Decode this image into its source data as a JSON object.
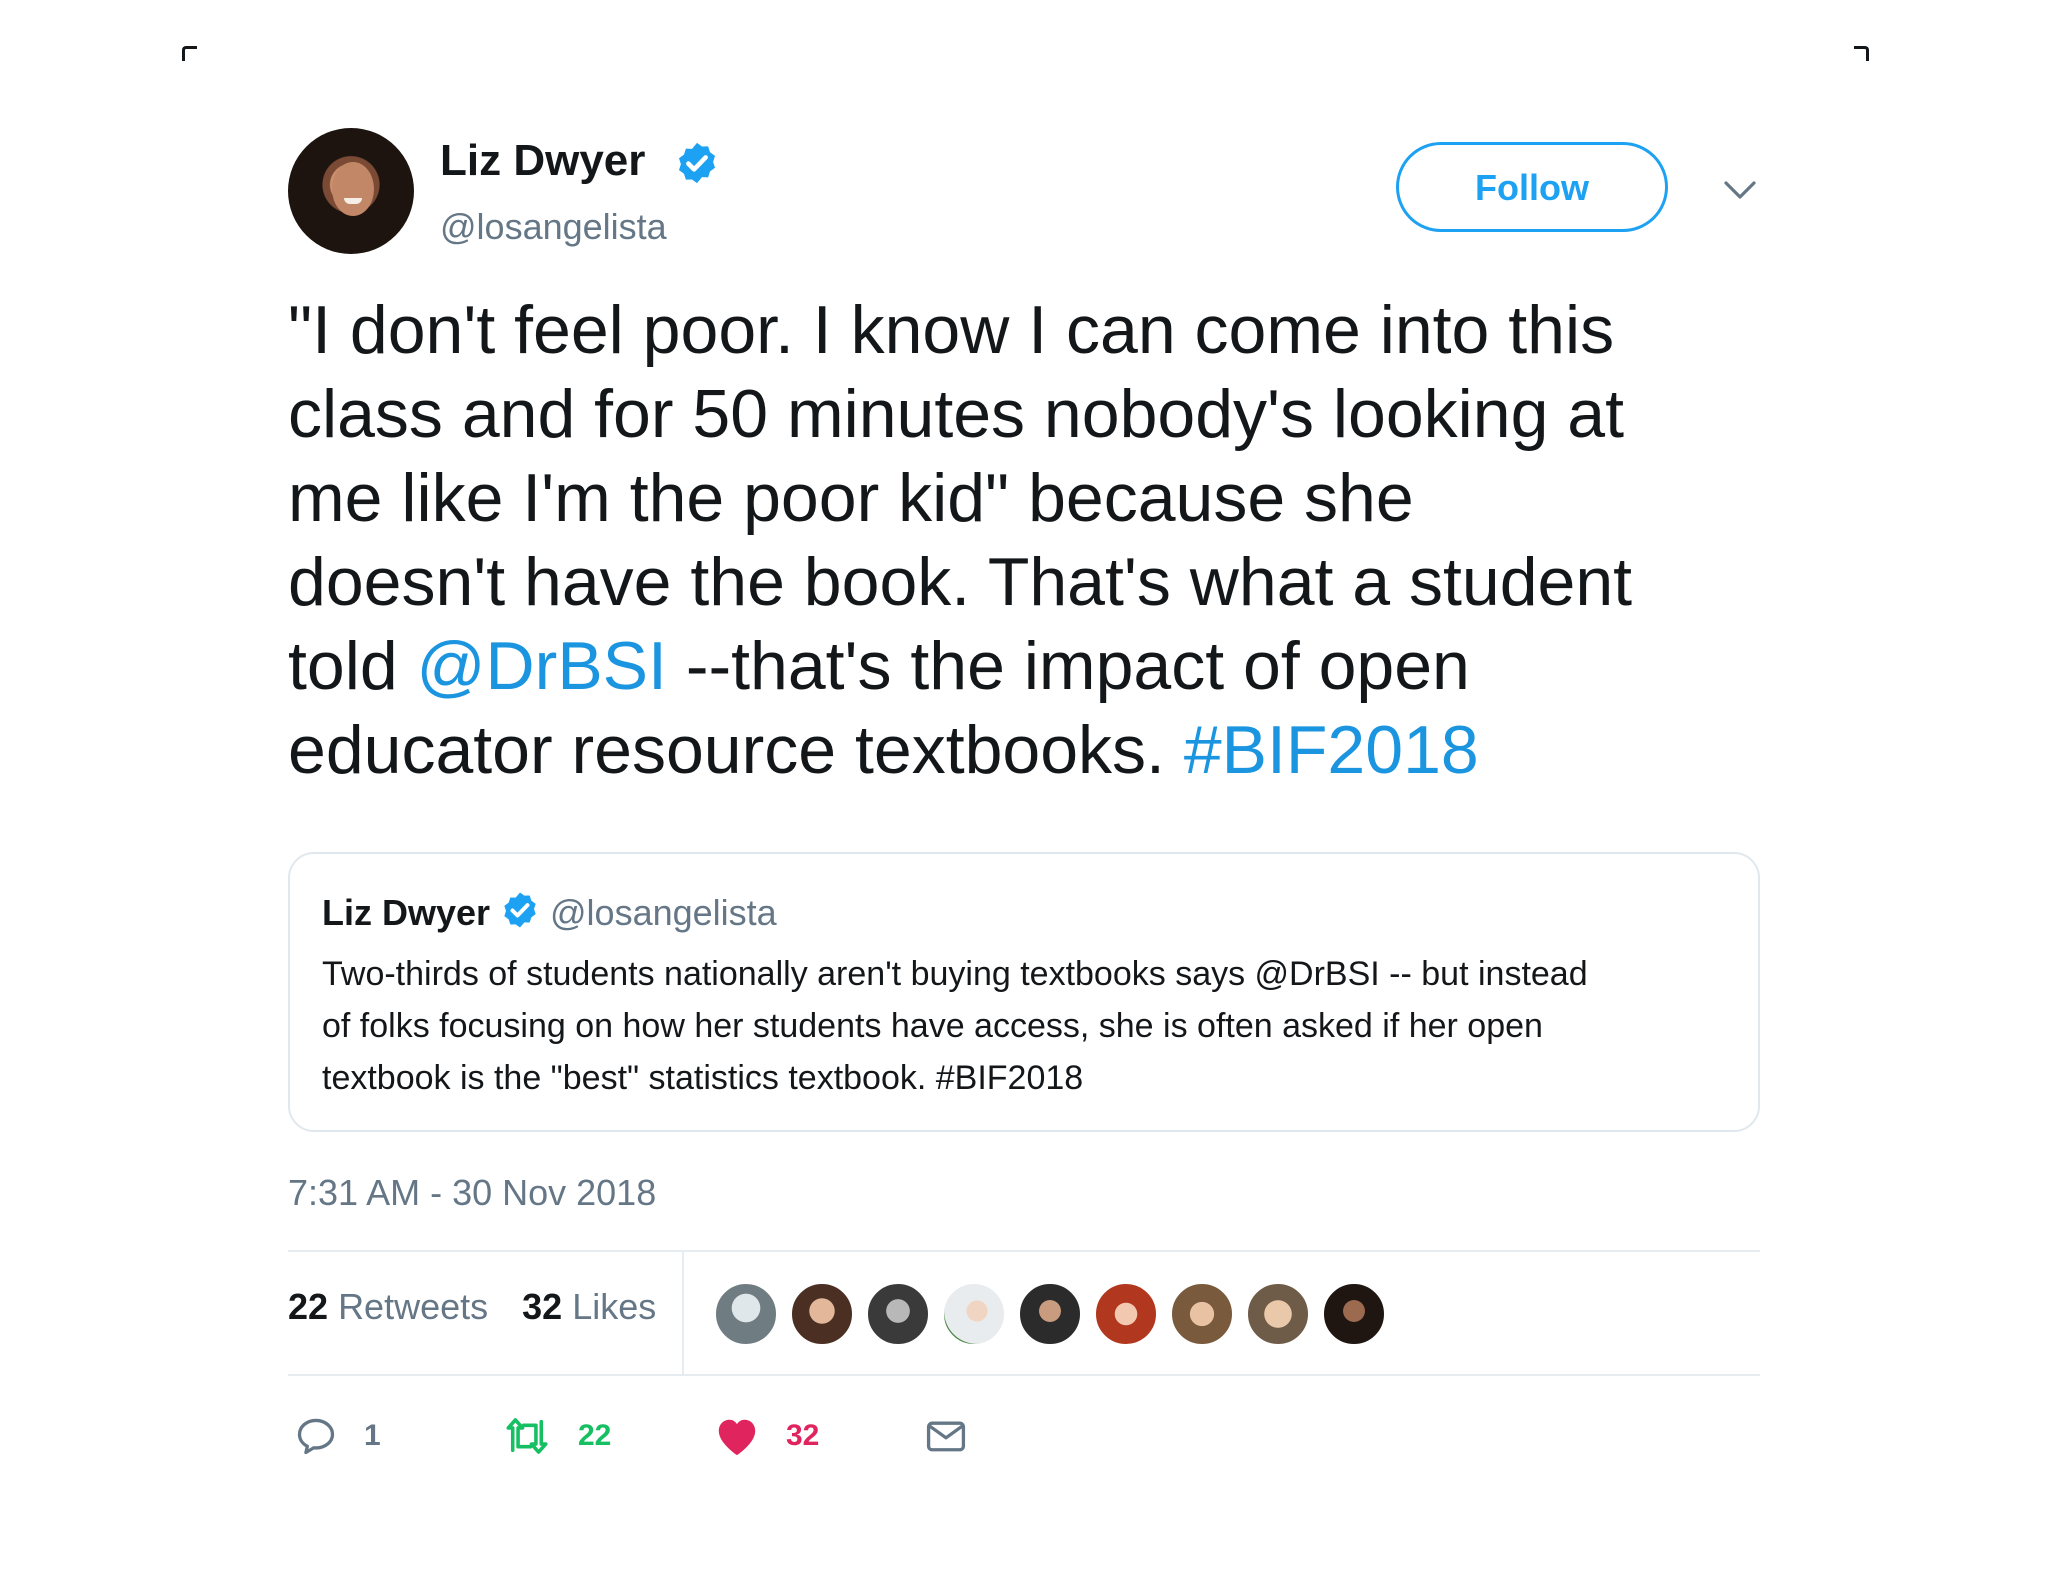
{
  "tweet": {
    "author_name": "Liz Dwyer",
    "author_handle": "@losangelista",
    "follow_label": "Follow",
    "text_lines": [
      {
        "plain": "\"I don't feel poor. I know I can come into this"
      },
      {
        "plain": "class and for 50 minutes nobody's looking at"
      },
      {
        "plain": "me like I'm the poor kid\" because she"
      },
      {
        "plain": "doesn't have the book. That's what a student"
      },
      {
        "pre": "told ",
        "link": "@DrBSI",
        "post": " --that's the impact of open"
      },
      {
        "pre": "educator resource textbooks. ",
        "link": "#BIF2018",
        "post": ""
      }
    ],
    "timestamp": "7:31 AM - 30 Nov 2018"
  },
  "quoted": {
    "author_name": "Liz Dwyer",
    "author_handle": "@losangelista",
    "text_lines": [
      "Two-thirds of students nationally aren't buying textbooks says @DrBSI -- but instead",
      "of folks focusing on how her students have access, she is often asked if her open",
      "textbook is the \"best\" statistics textbook. #BIF2018"
    ]
  },
  "stats": {
    "retweets_count": "22",
    "retweets_label": "Retweets",
    "likes_count": "32",
    "likes_label": "Likes"
  },
  "actions": {
    "reply_count": "1",
    "retweet_count": "22",
    "like_count": "32"
  },
  "colors": {
    "link": "#1b95e0",
    "verified": "#1da1f2",
    "retweet": "#17bf63",
    "like": "#e0245e",
    "muted": "#657786"
  }
}
